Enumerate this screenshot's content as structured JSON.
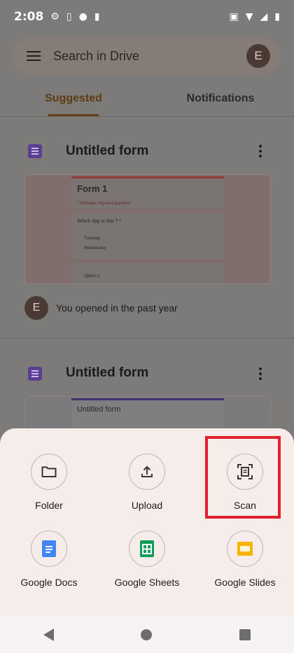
{
  "status_bar": {
    "time": "2:08"
  },
  "search": {
    "placeholder": "Search in Drive",
    "avatar_letter": "E"
  },
  "tabs": [
    {
      "label": "Suggested",
      "active": true
    },
    {
      "label": "Notifications",
      "active": false
    }
  ],
  "files": [
    {
      "title": "Untitled form",
      "preview": {
        "heading": "Form 1",
        "required_note": "* Indicates required question",
        "question": "Which day is this ? *",
        "options": [
          "Tuesday",
          "Wednesday"
        ],
        "extra": "Option 1"
      },
      "activity": {
        "avatar_letter": "E",
        "text": "You opened in the past year"
      }
    },
    {
      "title": "Untitled form",
      "preview": {
        "heading": "Untitled form"
      }
    }
  ],
  "new_sheet": {
    "actions": [
      {
        "label": "Folder",
        "icon": "folder-icon"
      },
      {
        "label": "Upload",
        "icon": "upload-icon"
      },
      {
        "label": "Scan",
        "icon": "scan-icon"
      },
      {
        "label": "Google Docs",
        "icon": "google-docs-icon"
      },
      {
        "label": "Google Sheets",
        "icon": "google-sheets-icon"
      },
      {
        "label": "Google Slides",
        "icon": "google-slides-icon"
      }
    ]
  },
  "colors": {
    "highlight": "#e0202a",
    "docs": "#4285f4",
    "sheets": "#0f9d58",
    "slides": "#f4b400",
    "form": "#5b3e91"
  }
}
